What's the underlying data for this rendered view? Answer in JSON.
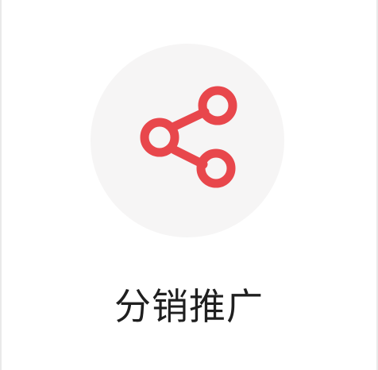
{
  "entry": {
    "label": "分销推广",
    "icon": "share-icon",
    "icon_color": "#e8474c",
    "circle_color": "#f6f5f5",
    "text_color": "#1f1f1f"
  }
}
